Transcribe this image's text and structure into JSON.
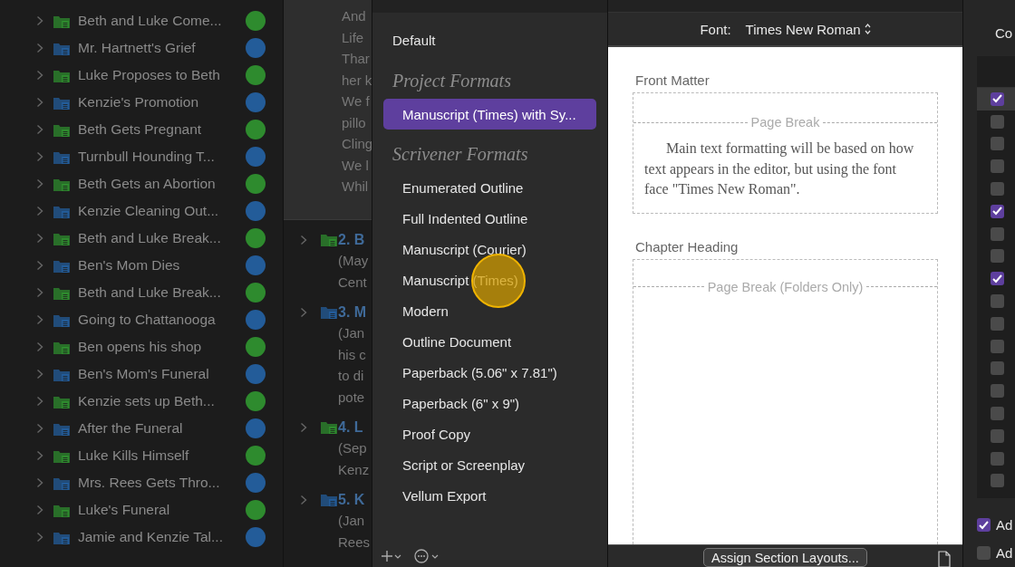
{
  "binder": {
    "items": [
      {
        "title": "Beth and Luke Come...",
        "color": "#2e8b2e"
      },
      {
        "title": "Mr. Hartnett's Grief",
        "color": "#235c99"
      },
      {
        "title": "Luke Proposes to Beth",
        "color": "#2e8b2e"
      },
      {
        "title": "Kenzie's Promotion",
        "color": "#235c99"
      },
      {
        "title": "Beth Gets Pregnant",
        "color": "#2e8b2e"
      },
      {
        "title": "Turnbull Hounding T...",
        "color": "#235c99"
      },
      {
        "title": "Beth Gets an Abortion",
        "color": "#2e8b2e"
      },
      {
        "title": "Kenzie Cleaning Out...",
        "color": "#235c99"
      },
      {
        "title": "Beth and Luke Break...",
        "color": "#2e8b2e"
      },
      {
        "title": "Ben's Mom Dies",
        "color": "#235c99"
      },
      {
        "title": "Beth and Luke Break...",
        "color": "#2e8b2e"
      },
      {
        "title": "Going to Chattanooga",
        "color": "#235c99"
      },
      {
        "title": "Ben opens his shop",
        "color": "#2e8b2e"
      },
      {
        "title": "Ben's Mom's Funeral",
        "color": "#235c99"
      },
      {
        "title": "Kenzie sets up Beth...",
        "color": "#2e8b2e"
      },
      {
        "title": "After the Funeral",
        "color": "#235c99"
      },
      {
        "title": "Luke Kills Himself",
        "color": "#2e8b2e"
      },
      {
        "title": "Mrs. Rees Gets Thro...",
        "color": "#235c99"
      },
      {
        "title": "Luke's Funeral",
        "color": "#2e8b2e"
      },
      {
        "title": "Jamie and Kenzie Tal...",
        "color": "#235c99"
      }
    ]
  },
  "editor": {
    "text_lines": [
      "And",
      "Life",
      "Thar",
      "her k",
      "We f",
      "pillo",
      "Cling",
      "We l",
      "Whil"
    ],
    "outline": [
      {
        "title": "2. B",
        "color": "#2e8b2e",
        "lines": [
          "(May",
          "Cent"
        ]
      },
      {
        "title": "3. M",
        "color": "#235c99",
        "lines": [
          "(Jan",
          "his c",
          "to di",
          "pote"
        ]
      },
      {
        "title": "4. L",
        "color": "#2e8b2e",
        "lines": [
          "(Sep",
          "Kenz"
        ]
      },
      {
        "title": "5. K",
        "color": "#235c99",
        "lines": [
          "(Jan",
          "Rees"
        ]
      }
    ]
  },
  "formats": {
    "default": "Default",
    "sections": [
      {
        "heading": "Project Formats",
        "items": [
          {
            "label": "Manuscript (Times) with Sy...",
            "selected": true,
            "cursor_over": false
          }
        ]
      },
      {
        "heading": "Scrivener Formats",
        "items": [
          {
            "label": "Enumerated Outline",
            "selected": false,
            "cursor_over": false
          },
          {
            "label": "Full Indented Outline",
            "selected": false,
            "cursor_over": false
          },
          {
            "label": "Manuscript (Courier)",
            "selected": false,
            "cursor_over": false
          },
          {
            "label": "Manuscript (Times)",
            "selected": false,
            "cursor_over": true
          },
          {
            "label": "Modern",
            "selected": false,
            "cursor_over": false
          },
          {
            "label": "Outline Document",
            "selected": false,
            "cursor_over": false
          },
          {
            "label": "Paperback (5.06\" x 7.81\")",
            "selected": false,
            "cursor_over": false
          },
          {
            "label": "Paperback (6\" x 9\")",
            "selected": false,
            "cursor_over": false
          },
          {
            "label": "Proof Copy",
            "selected": false,
            "cursor_over": false
          },
          {
            "label": "Script or Screenplay",
            "selected": false,
            "cursor_over": false
          },
          {
            "label": "Vellum Export",
            "selected": false,
            "cursor_over": false
          }
        ]
      }
    ]
  },
  "section_layouts": {
    "font_label": "Font:",
    "font_value": "Times New Roman",
    "layouts": [
      {
        "title": "Front Matter",
        "break_label": "Page Break",
        "body": "Main text formatting will be based on how text appears in the editor, but using the font face \"Times New Roman\"."
      },
      {
        "title": "Chapter Heading",
        "break_label": "Page Break (Folders Only)"
      }
    ],
    "assign_button": "Assign Section Layouts..."
  },
  "right_panel": {
    "label": "Co",
    "rows": [
      {
        "checked": true,
        "selected": true
      },
      {
        "checked": false,
        "selected": false
      },
      {
        "checked": false,
        "selected": false
      },
      {
        "checked": false,
        "selected": false
      },
      {
        "checked": false,
        "selected": false
      },
      {
        "checked": true,
        "selected": false
      },
      {
        "checked": false,
        "selected": false
      },
      {
        "checked": false,
        "selected": false
      },
      {
        "checked": true,
        "selected": false
      },
      {
        "checked": false,
        "selected": false
      },
      {
        "checked": false,
        "selected": false
      },
      {
        "checked": false,
        "selected": false
      },
      {
        "checked": false,
        "selected": false
      },
      {
        "checked": false,
        "selected": false
      },
      {
        "checked": false,
        "selected": false
      },
      {
        "checked": false,
        "selected": false
      },
      {
        "checked": false,
        "selected": false
      },
      {
        "checked": false,
        "selected": false
      }
    ],
    "options": [
      {
        "label": "Ad",
        "checked": true
      },
      {
        "label": "Ad",
        "checked": false
      }
    ]
  }
}
